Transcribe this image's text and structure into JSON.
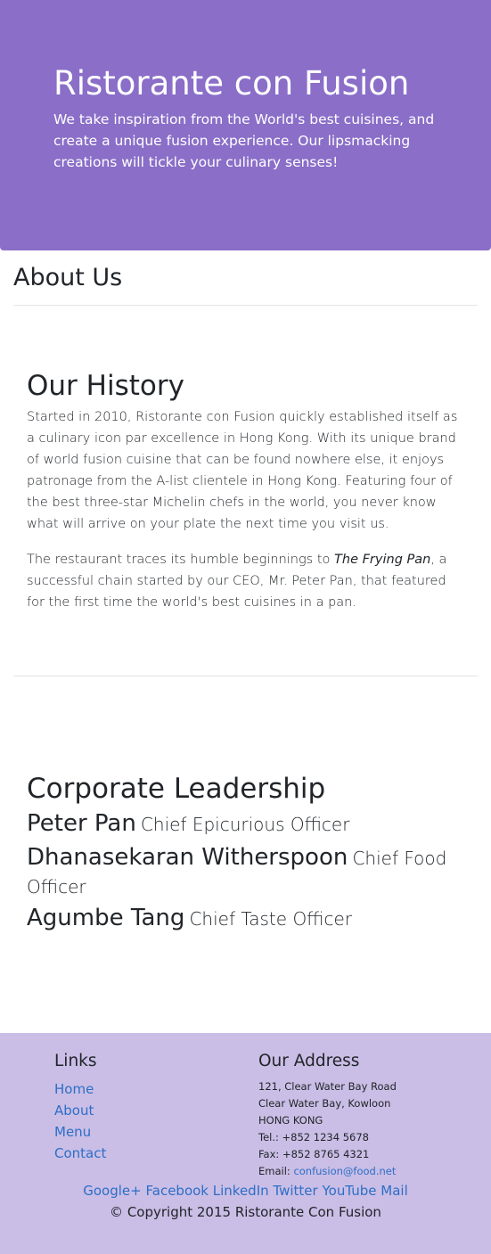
{
  "header": {
    "title": "Ristorante con Fusion",
    "tagline": "We take inspiration from the World's best cuisines, and create a unique fusion experience. Our lipsmacking creations will tickle your culinary senses!"
  },
  "about": {
    "heading": "About Us"
  },
  "history": {
    "heading": "Our History",
    "paragraph1": "Started in 2010, Ristorante con Fusion quickly established itself as a culinary icon par excellence in Hong Kong. With its unique brand of world fusion cuisine that can be found nowhere else, it enjoys patronage from the A-list clientele in Hong Kong. Featuring four of the best three-star Michelin chefs in the world, you never know what will arrive on your plate the next time you visit us.",
    "paragraph2_before": "The restaurant traces its humble beginnings to ",
    "paragraph2_emph": "The Frying Pan",
    "paragraph2_after": ", a successful chain started by our CEO, Mr. Peter Pan, that featured for the first time the world's best cuisines in a pan."
  },
  "leadership": {
    "heading": "Corporate Leadership",
    "leaders": [
      {
        "name": "Peter Pan",
        "title": "Chief Epicurious Officer"
      },
      {
        "name": "Dhanasekaran Witherspoon",
        "title": "Chief Food Officer"
      },
      {
        "name": "Agumbe Tang",
        "title": "Chief Taste Officer"
      }
    ]
  },
  "footer": {
    "links_heading": "Links",
    "links": [
      "Home",
      "About",
      "Menu",
      "Contact"
    ],
    "address_heading": "Our Address",
    "address_lines": [
      "121, Clear Water Bay Road",
      "Clear Water Bay, Kowloon",
      "HONG KONG"
    ],
    "tel": "Tel.: +852 1234 5678",
    "fax": "Fax: +852 8765 4321",
    "email_label": "Email: ",
    "email": "confusion@food.net",
    "social": [
      "Google+",
      "Facebook",
      "LinkedIn",
      "Twitter",
      "YouTube",
      "Mail"
    ],
    "copyright": "© Copyright 2015 Ristorante Con Fusion"
  },
  "colors": {
    "header_bg": "#8a6ec8",
    "footer_bg": "#cabee6",
    "link": "#2d6ec6"
  }
}
